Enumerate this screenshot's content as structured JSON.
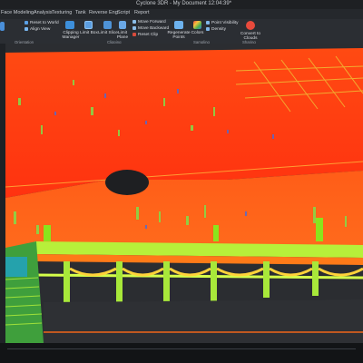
{
  "window": {
    "title": "Cyclone 3DR - My Document 12:04:39*"
  },
  "tabs": [
    "Face Modeling",
    "Analysis",
    "Texturing",
    "Tank",
    "Reverse Eng",
    "Script",
    "Report"
  ],
  "ribbon": {
    "left_truncated": "Orientation",
    "reset_to_world": "Reset to World",
    "align_view": "Align View",
    "clipping_manager": "Clipping\nManager",
    "limit_box": "Limit Box",
    "limit_slice": "Limit Slice",
    "limit_plane": "Limit\nPlane",
    "move_forward": "Move Forward",
    "move_backward": "Move Backward",
    "reset_clip": "Reset Clip",
    "regenerate_points": "Regenerate\nPoints",
    "colors": "Colors",
    "point_visibility": "Point Visibility",
    "density": "Density",
    "convert_to_clouds": "Convert to\nClouds",
    "groups": {
      "orientation": "Orientation",
      "clipping": "Clipping",
      "sampling": "Sampling",
      "sharing": "Sharing"
    }
  },
  "colors": {
    "accent": "#3a7bd5",
    "warn": "#e84a3c",
    "cloud_red": "#ff3b10",
    "cloud_orange": "#ff6a14",
    "cloud_green": "#8fe01a"
  }
}
